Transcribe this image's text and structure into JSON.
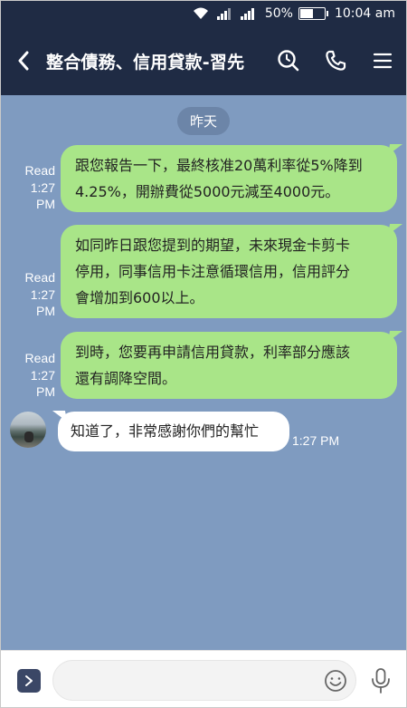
{
  "status_bar": {
    "battery_percent": "50%",
    "battery_level": 0.5,
    "time": "10:04 am"
  },
  "header": {
    "title": "整合債務、信用貸款-習先"
  },
  "chat": {
    "date_label": "昨天",
    "outgoing": [
      {
        "read_label": "Read",
        "time_line1": "1:27",
        "time_line2": "PM",
        "text_line1": "跟您報告一下，最終核准20萬利率從5%降到",
        "text_line2": "4.25%，開辦費從5000元減至4000元。",
        "text_line3": ""
      },
      {
        "read_label": "Read",
        "time_line1": "1:27",
        "time_line2": "PM",
        "text_line1": "如同昨日跟您提到的期望，未來現金卡剪卡",
        "text_line2": "停用，同事信用卡注意循環信用，信用評分",
        "text_line3": "會增加到600以上。"
      },
      {
        "read_label": "Read",
        "time_line1": "1:27",
        "time_line2": "PM",
        "text_line1": "到時，您要再申請信用貸款，利率部分應該",
        "text_line2": "還有調降空間。",
        "text_line3": ""
      }
    ],
    "incoming": [
      {
        "text": "知道了，非常感謝你們的幫忙",
        "time": "1:27 PM"
      }
    ]
  },
  "input": {
    "placeholder": ""
  },
  "colors": {
    "header_bg": "#1f2b44",
    "chat_bg": "#7f9bc0",
    "outgoing_bubble": "#a9e588",
    "incoming_bubble": "#ffffff"
  }
}
